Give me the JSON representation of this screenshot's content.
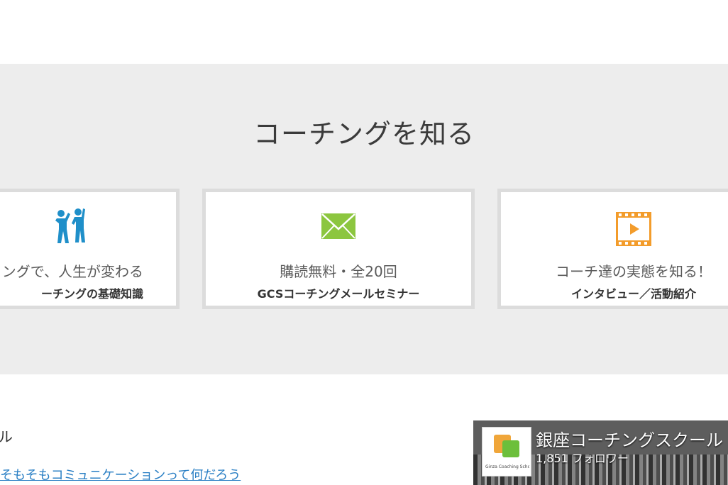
{
  "section": {
    "title": "コーチングを知る"
  },
  "cards": [
    {
      "icon": "people-icon",
      "line1": "ングで、人生が変わる",
      "line2": "ーチングの基礎知識"
    },
    {
      "icon": "mail-icon",
      "line1": "購読無料・全20回",
      "line2": "GCSコーチングメールセミナー"
    },
    {
      "icon": "video-icon",
      "line1": "コーチ達の実態を知る！",
      "line2": "インタビュー／活動紹介"
    }
  ],
  "bottom": {
    "heading": "ル",
    "link": "そもそもコミュニケーションって何だろう"
  },
  "fb_widget": {
    "page_name": "銀座コーチングスクール",
    "followers": "1,851 フォロワー",
    "logo_text": "Ginza Coaching School"
  },
  "colors": {
    "people_icon": "#1f8fc9",
    "mail_icon": "#8cc63f",
    "video_icon": "#f39c2b",
    "link": "#2a7fc4"
  }
}
